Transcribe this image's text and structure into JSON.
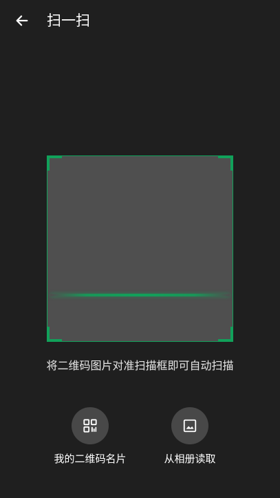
{
  "header": {
    "back_icon": "arrow-left-icon",
    "title": "扫一扫"
  },
  "scanner": {
    "frame_color": "#11a15a",
    "hint": "将二维码图片对准扫描框即可自动扫描"
  },
  "actions": {
    "my_qr": {
      "icon": "qr-code-icon",
      "label": "我的二维码名片"
    },
    "album": {
      "icon": "image-icon",
      "label": "从相册读取"
    }
  },
  "colors": {
    "background": "#1f1f1f",
    "accent": "#11a15a",
    "button_bg": "#484848",
    "frame_fill": "#4f4f4f"
  }
}
